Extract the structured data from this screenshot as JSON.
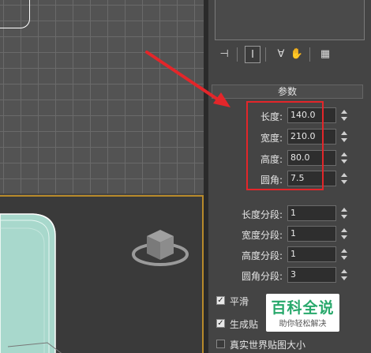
{
  "toolbar": {
    "icons": [
      "pin-stack-icon",
      "show-end-result-icon",
      "make-unique-icon",
      "remove-modifier-icon",
      "configure-sets-icon"
    ]
  },
  "rollout": {
    "title": "参数"
  },
  "params": [
    {
      "label": "长度:",
      "value": "140.0"
    },
    {
      "label": "宽度:",
      "value": "210.0"
    },
    {
      "label": "高度:",
      "value": "80.0"
    },
    {
      "label": "圆角:",
      "value": "7.5"
    }
  ],
  "segments": [
    {
      "label": "长度分段:",
      "value": "1"
    },
    {
      "label": "宽度分段:",
      "value": "1"
    },
    {
      "label": "高度分段:",
      "value": "1"
    },
    {
      "label": "圆角分段:",
      "value": "3"
    }
  ],
  "options": [
    {
      "label": "平滑",
      "checked": true
    },
    {
      "label": "生成贴",
      "checked": true
    },
    {
      "label": "真实世界贴图大小",
      "checked": false
    }
  ],
  "watermark": {
    "title": "百科全说",
    "subtitle": "助你轻松解决"
  },
  "colors": {
    "highlight": "#e3262a",
    "active_viewport_border": "#b88a2b",
    "watermark_green": "#28a86b"
  }
}
